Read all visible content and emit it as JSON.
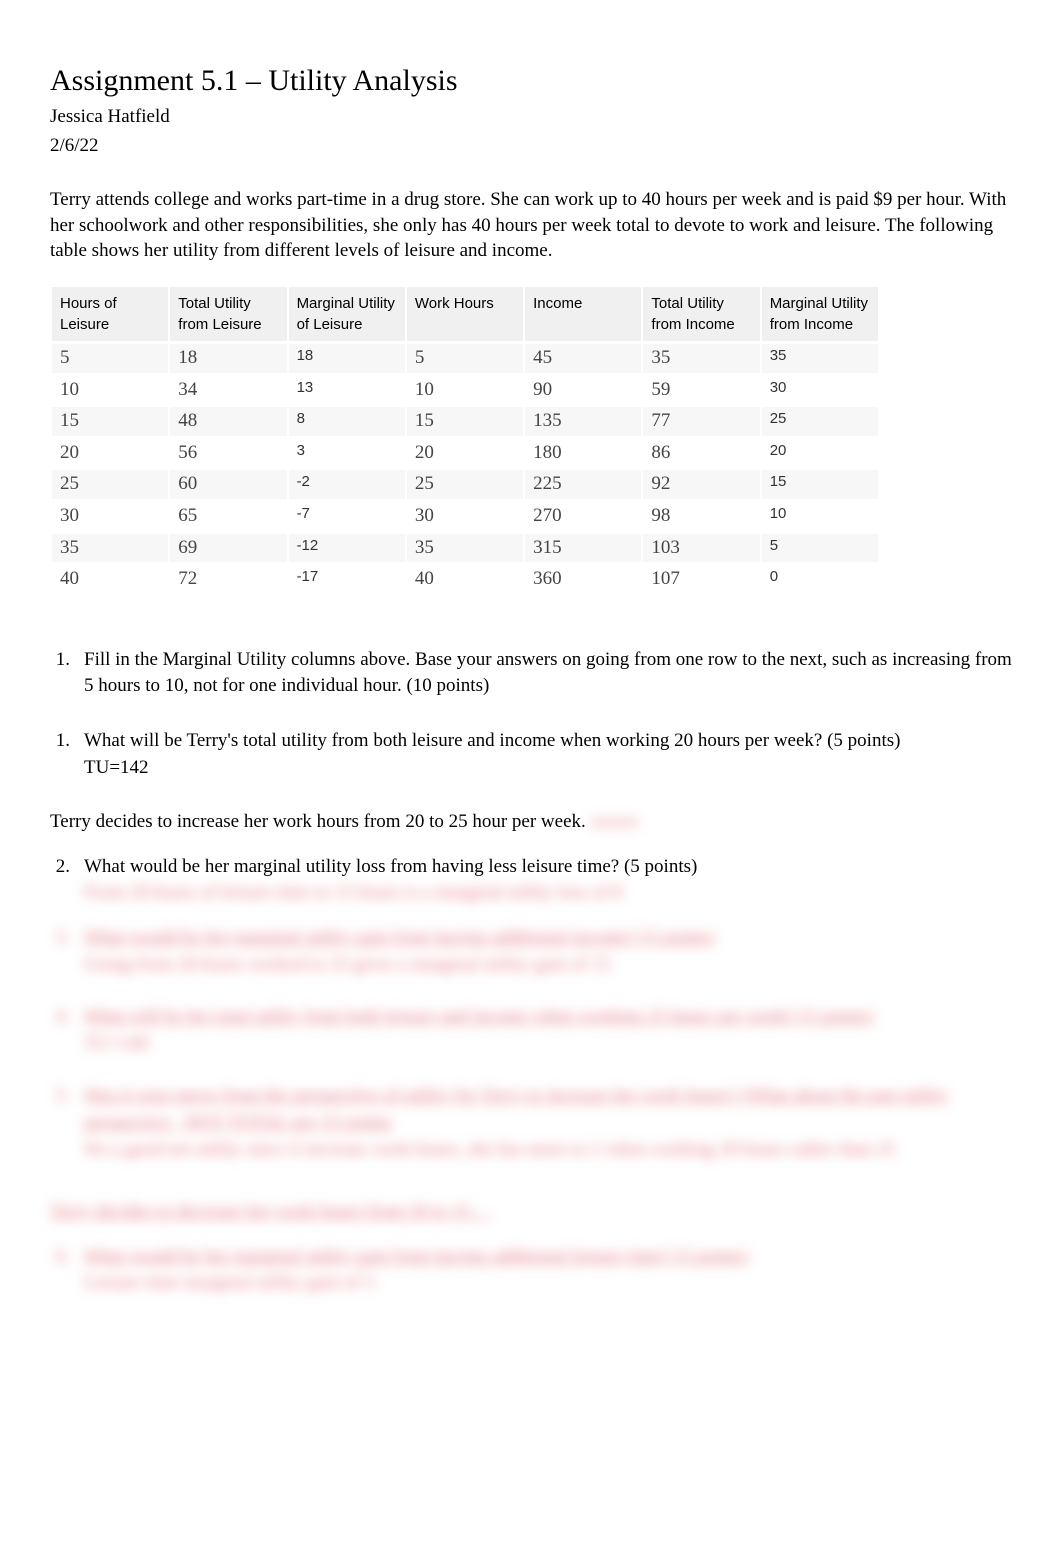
{
  "header": {
    "title": "Assignment 5.1 – Utility Analysis",
    "author": "Jessica Hatfield",
    "date": "2/6/22"
  },
  "intro": "Terry attends college and works part-time in a drug store. She can work up to 40 hours per week and is paid $9 per hour. With her schoolwork and other responsibilities, she only has 40 hours per week total to devote to work and leisure. The following table shows her utility from different levels of leisure and income.",
  "table": {
    "headers": [
      "Hours of Leisure",
      "Total Utility from Leisure",
      "Marginal Utility of Leisure",
      "Work Hours",
      "Income",
      "Total Utility from Income",
      "Marginal Utility from Income"
    ],
    "rows": [
      {
        "hl": "5",
        "tul": "18",
        "mul": "18",
        "wh": "5",
        "inc": "45",
        "tui": "35",
        "mui": "35"
      },
      {
        "hl": "10",
        "tul": "34",
        "mul": "13",
        "wh": "10",
        "inc": "90",
        "tui": "59",
        "mui": "30"
      },
      {
        "hl": "15",
        "tul": "48",
        "mul": "8",
        "wh": "15",
        "inc": "135",
        "tui": "77",
        "mui": "25"
      },
      {
        "hl": "20",
        "tul": "56",
        "mul": "3",
        "wh": "20",
        "inc": "180",
        "tui": "86",
        "mui": "20"
      },
      {
        "hl": "25",
        "tul": "60",
        "mul": "-2",
        "wh": "25",
        "inc": "225",
        "tui": "92",
        "mui": "15"
      },
      {
        "hl": "30",
        "tul": "65",
        "mul": "-7",
        "wh": "30",
        "inc": "270",
        "tui": "98",
        "mui": "10"
      },
      {
        "hl": "35",
        "tul": "69",
        "mul": "-12",
        "wh": "35",
        "inc": "315",
        "tui": "103",
        "mui": "5"
      },
      {
        "hl": "40",
        "tul": "72",
        "mul": "-17",
        "wh": "40",
        "inc": "360",
        "tui": "107",
        "mui": "0"
      }
    ]
  },
  "questions": {
    "q1": {
      "num": "1.",
      "text": "Fill in the Marginal Utility columns above. Base your answers on going from one row to the next, such as increasing from 5 hours to 10, not for one individual hour. (10 points)"
    },
    "q2": {
      "num": "1.",
      "text": "What will be Terry's total utility from both leisure and income when working 20 hours per week? (5 points)",
      "answer": "TU=142"
    },
    "transition1": "Terry decides to increase her work hours from 20 to 25 hour per week.",
    "q3": {
      "num": "2.",
      "text": "What would be her marginal utility loss from having less leisure time? (5 points)",
      "blurred": "From 20 hours of leisure time to 15 hours is a marginal utility loss of 8"
    },
    "q4": {
      "num": "3.",
      "text_blurred": "What would be her marginal utility gain from having additional income? (5 points)",
      "answer_blurred": "Going from 20 hours worked to 25 gives a marginal utility gain of 15"
    },
    "q5": {
      "num": "4.",
      "text_blurred": "What will be her total utility from both leisure and income when working 25 hours per week? (5 points)",
      "answer_blurred": "TU=140"
    },
    "q6": {
      "num": "5.",
      "text_blurred": "Was it wise move from the perspective of utility for Terry to increase her work hours? (What about the part utility  perspective , NOT TOTAL per 15 points",
      "answer_blurred": "No a good net utility since it increase work hours, she has more to 2 when working 20 hours rather than 25"
    },
    "transition2_blurred": "Terry decides to decrease her work hours from 20 to 15 . .",
    "q7": {
      "num": "6.",
      "text_blurred": "What would be her marginal utility gain from having additional leisure time? (5 points)",
      "answer_blurred": "Leisure time marginal utility gain of 3"
    }
  }
}
